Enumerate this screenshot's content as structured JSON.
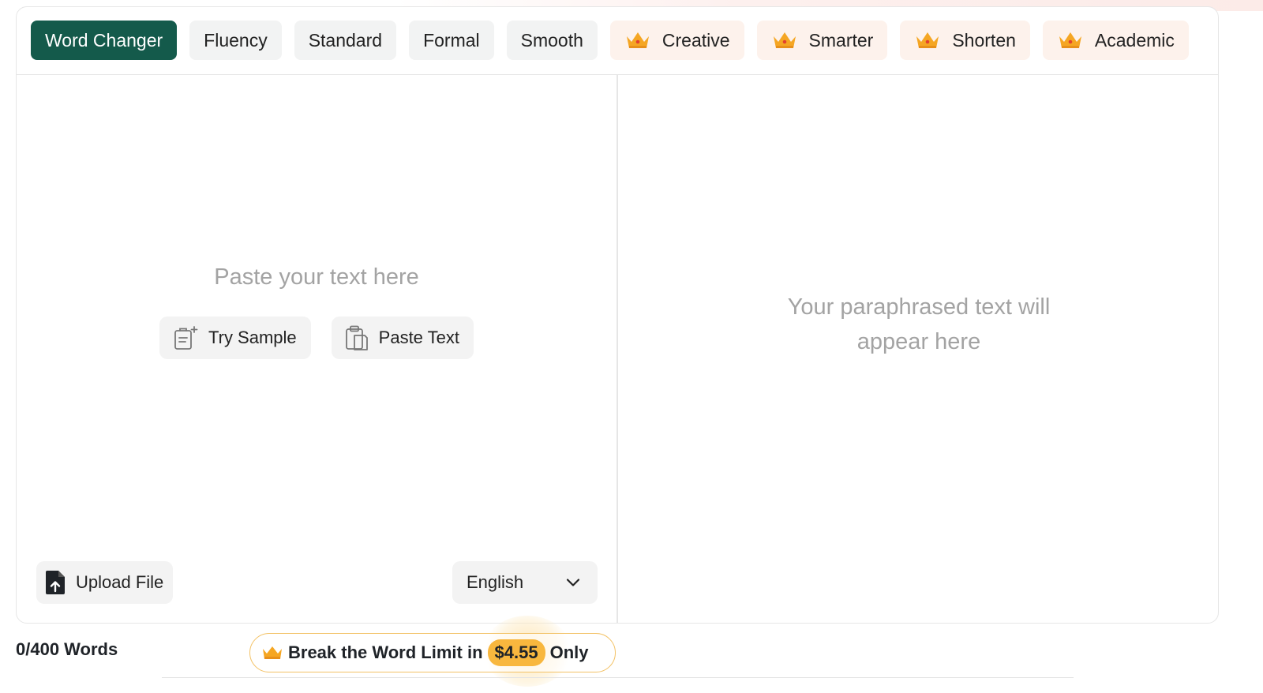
{
  "modes": [
    {
      "label": "Word Changer",
      "active": true,
      "premium": false
    },
    {
      "label": "Fluency",
      "active": false,
      "premium": false
    },
    {
      "label": "Standard",
      "active": false,
      "premium": false
    },
    {
      "label": "Formal",
      "active": false,
      "premium": false
    },
    {
      "label": "Smooth",
      "active": false,
      "premium": false
    },
    {
      "label": "Creative",
      "active": false,
      "premium": true
    },
    {
      "label": "Smarter",
      "active": false,
      "premium": true
    },
    {
      "label": "Shorten",
      "active": false,
      "premium": true
    },
    {
      "label": "Academic",
      "active": false,
      "premium": true
    }
  ],
  "input": {
    "placeholder": "Paste your text here",
    "try_sample_label": "Try Sample",
    "paste_text_label": "Paste Text",
    "upload_file_label": "Upload File",
    "language": "English"
  },
  "output": {
    "placeholder_line1": "Your paraphrased text will",
    "placeholder_line2": "appear here"
  },
  "footer": {
    "word_count": "0/400 Words",
    "upsell_prefix": "Break the Word Limit in",
    "upsell_price": "$4.55",
    "upsell_suffix": "Only"
  },
  "colors": {
    "active_mode": "#145a4b",
    "premium_bg": "#fdf2ec",
    "price_badge": "#f8b73e",
    "crown": "#f5a623"
  },
  "icons": {
    "premium": "crown-icon",
    "try_sample": "clipboard-sample-icon",
    "paste_text": "clipboard-paste-icon",
    "upload": "file-upload-icon",
    "language_dropdown": "chevron-down-icon"
  }
}
